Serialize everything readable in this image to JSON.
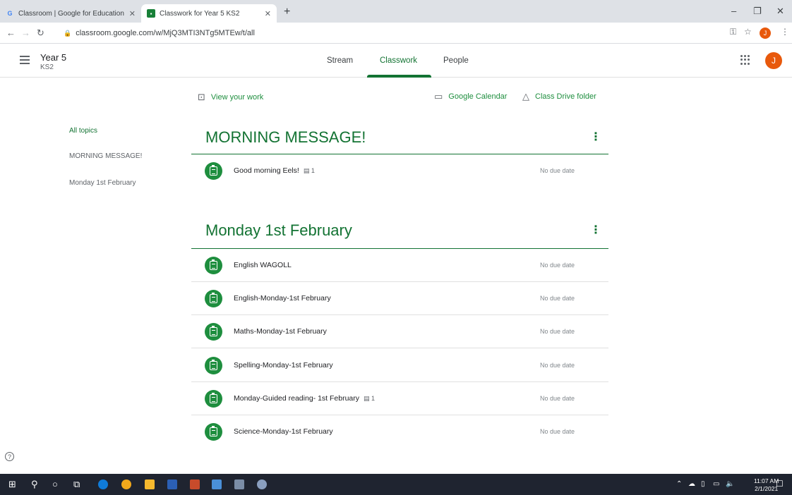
{
  "browser": {
    "tabs": [
      {
        "title": "Classroom | Google for Education",
        "favicon": "google-g",
        "close": "✕"
      },
      {
        "title": "Classwork for Year 5 KS2",
        "favicon": "classroom-icon",
        "close": "✕"
      }
    ],
    "new_tab": "+",
    "url": "classroom.google.com/w/MjQ3MTI3NTg5MTEw/t/all",
    "profile_initial": "J"
  },
  "app": {
    "class_name": "Year 5",
    "section": "KS2",
    "tabs": [
      "Stream",
      "Classwork",
      "People"
    ],
    "active_tab": "Classwork",
    "user_initial": "J",
    "accent": "#137333"
  },
  "actions": {
    "view_work": "View your work",
    "calendar": "Google Calendar",
    "drive": "Class Drive folder"
  },
  "sidebar": [
    "All topics",
    "MORNING MESSAGE!",
    "Monday 1st February"
  ],
  "topics": [
    {
      "title": "MORNING MESSAGE!",
      "items": [
        {
          "title": "Good morning Eels!",
          "comments": "1",
          "due": "No due date"
        }
      ]
    },
    {
      "title": "Monday 1st February",
      "items": [
        {
          "title": "English WAGOLL",
          "comments": "",
          "due": "No due date"
        },
        {
          "title": "English-Monday-1st February",
          "comments": "",
          "due": "No due date"
        },
        {
          "title": "Maths-Monday-1st February",
          "comments": "",
          "due": "No due date"
        },
        {
          "title": "Spelling-Monday-1st February",
          "comments": "",
          "due": "No due date"
        },
        {
          "title": "Monday-Guided reading- 1st February",
          "comments": "1",
          "due": "No due date"
        },
        {
          "title": "Science-Monday-1st February",
          "comments": "",
          "due": "No due date"
        }
      ]
    }
  ],
  "taskbar": {
    "time": "11:07 AM",
    "date": "2/1/2021"
  }
}
